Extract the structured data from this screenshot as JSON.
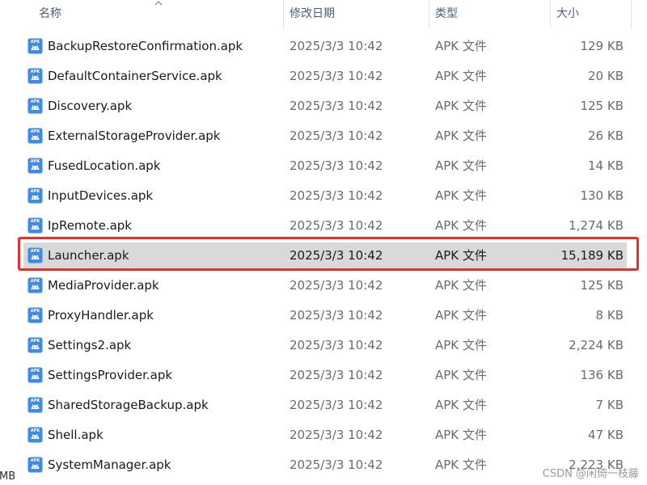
{
  "columns": {
    "name": "名称",
    "date": "修改日期",
    "type": "类型",
    "size": "大小"
  },
  "sort": {
    "column": "name",
    "icon": "sort-ascending-chevron-icon"
  },
  "file_icon": {
    "label": "APK",
    "icon": "android-apk-icon",
    "color": "#3c8ce7"
  },
  "files": [
    {
      "name": "BackupRestoreConfirmation.apk",
      "date": "2025/3/3 10:42",
      "type": "APK 文件",
      "size": "129 KB"
    },
    {
      "name": "DefaultContainerService.apk",
      "date": "2025/3/3 10:42",
      "type": "APK 文件",
      "size": "20 KB"
    },
    {
      "name": "Discovery.apk",
      "date": "2025/3/3 10:42",
      "type": "APK 文件",
      "size": "125 KB"
    },
    {
      "name": "ExternalStorageProvider.apk",
      "date": "2025/3/3 10:42",
      "type": "APK 文件",
      "size": "26 KB"
    },
    {
      "name": "FusedLocation.apk",
      "date": "2025/3/3 10:42",
      "type": "APK 文件",
      "size": "14 KB"
    },
    {
      "name": "InputDevices.apk",
      "date": "2025/3/3 10:42",
      "type": "APK 文件",
      "size": "130 KB"
    },
    {
      "name": "IpRemote.apk",
      "date": "2025/3/3 10:42",
      "type": "APK 文件",
      "size": "1,274 KB"
    },
    {
      "name": "Launcher.apk",
      "date": "2025/3/3 10:42",
      "type": "APK 文件",
      "size": "15,189 KB",
      "selected": true
    },
    {
      "name": "MediaProvider.apk",
      "date": "2025/3/3 10:42",
      "type": "APK 文件",
      "size": "125 KB"
    },
    {
      "name": "ProxyHandler.apk",
      "date": "2025/3/3 10:42",
      "type": "APK 文件",
      "size": "8 KB"
    },
    {
      "name": "Settings2.apk",
      "date": "2025/3/3 10:42",
      "type": "APK 文件",
      "size": "2,224 KB"
    },
    {
      "name": "SettingsProvider.apk",
      "date": "2025/3/3 10:42",
      "type": "APK 文件",
      "size": "136 KB"
    },
    {
      "name": "SharedStorageBackup.apk",
      "date": "2025/3/3 10:42",
      "type": "APK 文件",
      "size": "7 KB"
    },
    {
      "name": "Shell.apk",
      "date": "2025/3/3 10:42",
      "type": "APK 文件",
      "size": "47 KB"
    },
    {
      "name": "SystemManager.apk",
      "date": "2025/3/3 10:42",
      "type": "APK 文件",
      "size": "2,223 KB"
    }
  ],
  "status_fragment": "MB",
  "watermark": "CSDN @闲倚一枝藤",
  "highlight_color": "#e53127",
  "selected_row_color": "#d9d9d9"
}
